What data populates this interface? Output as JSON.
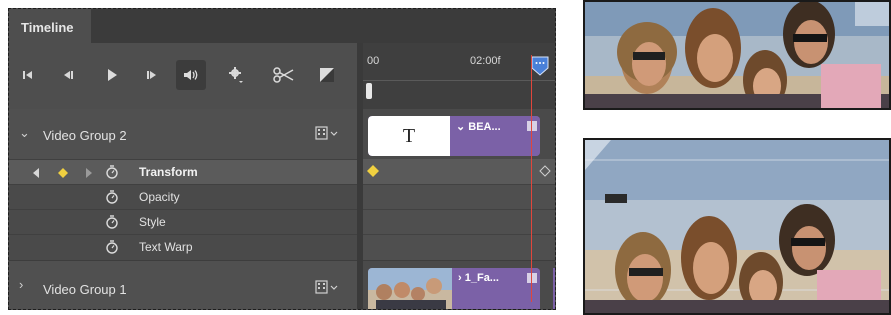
{
  "timeline": {
    "tab_label": "Timeline",
    "toolbar": {
      "buttons": [
        {
          "name": "go-to-first-frame",
          "icon": "skip-to-start-icon"
        },
        {
          "name": "previous-frame",
          "icon": "step-back-icon"
        },
        {
          "name": "play",
          "icon": "play-icon"
        },
        {
          "name": "next-frame",
          "icon": "step-forward-icon"
        },
        {
          "name": "audio",
          "icon": "speaker-icon"
        },
        {
          "name": "settings",
          "icon": "gear-icon"
        },
        {
          "name": "split-at-playhead",
          "icon": "scissors-icon"
        },
        {
          "name": "transition",
          "icon": "transition-icon"
        }
      ]
    },
    "ruler": {
      "start_label": "00",
      "end_label": "02:00f"
    },
    "groups": [
      {
        "name": "Video Group 2",
        "expanded": true,
        "clip": {
          "name": "BEA...",
          "kind": "text",
          "thumb_text": "T"
        },
        "properties": [
          {
            "label": "Transform",
            "selected": true
          },
          {
            "label": "Opacity",
            "selected": false
          },
          {
            "label": "Style",
            "selected": false
          },
          {
            "label": "Text Warp",
            "selected": false
          }
        ]
      },
      {
        "name": "Video Group 1",
        "expanded": false,
        "clip": {
          "name": "1_Fa...",
          "kind": "image"
        }
      }
    ],
    "colors": {
      "clip_purple": "#7b61a7",
      "playhead": "#e0463c",
      "keyframe": "#f0d040"
    }
  },
  "previews": [
    {
      "name": "photo-preview-top"
    },
    {
      "name": "photo-preview-bottom"
    }
  ]
}
